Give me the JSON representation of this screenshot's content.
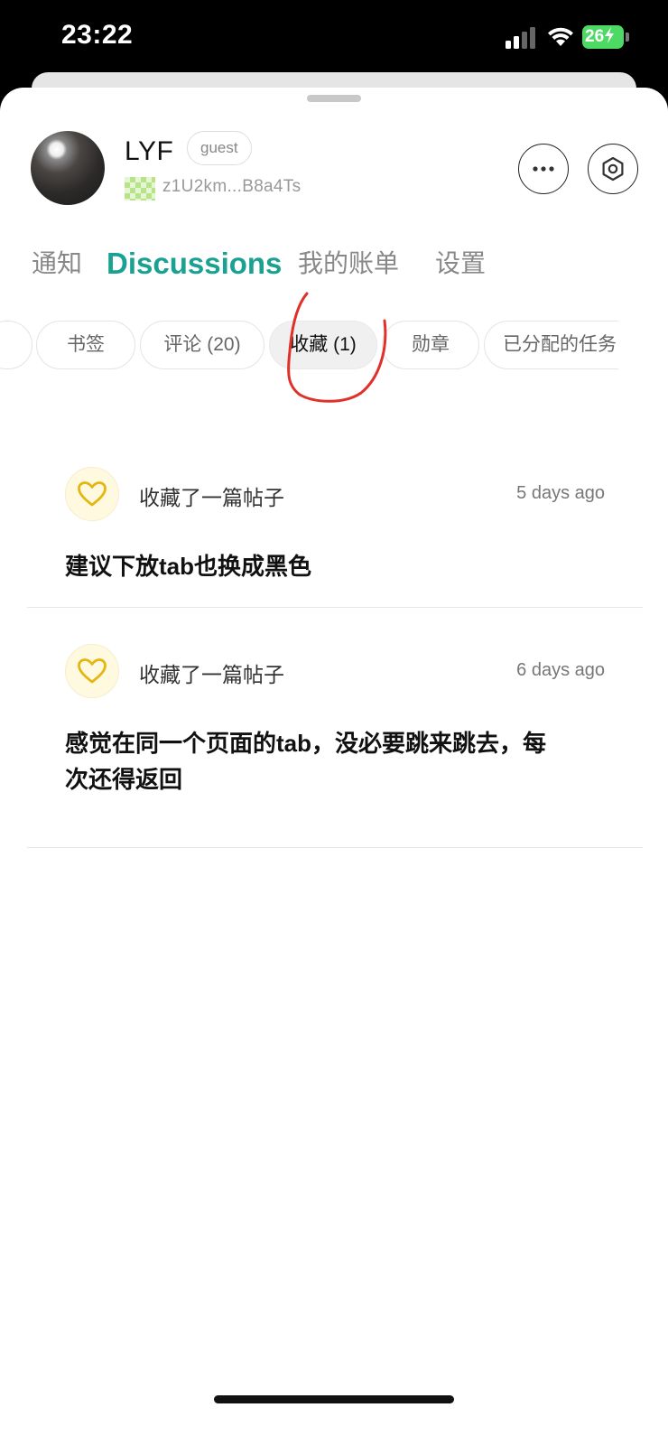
{
  "status_bar": {
    "time": "23:22",
    "battery": "26"
  },
  "profile": {
    "name": "LYF",
    "role": "guest",
    "wallet_address": "z1U2km...B8a4Ts"
  },
  "main_tabs": [
    {
      "label": "通知"
    },
    {
      "label": "Discussions",
      "active": true
    },
    {
      "label": "我的账单"
    },
    {
      "label": "设置"
    }
  ],
  "sub_tabs": [
    {
      "label": "书签"
    },
    {
      "label": "评论 (20)"
    },
    {
      "label": "收藏 (1)",
      "active": true
    },
    {
      "label": "勋章"
    },
    {
      "label": "已分配的任务"
    }
  ],
  "feed": [
    {
      "activity": "收藏了一篇帖子",
      "time": "5 days ago",
      "title": "建议下放tab也换成黑色"
    },
    {
      "activity": "收藏了一篇帖子",
      "time": "6 days ago",
      "title": "感觉在同一个页面的tab，没必要跳来跳去，每次还得返回"
    }
  ],
  "colors": {
    "accent": "#1aa192",
    "heart": "#e5b611",
    "annotation": "#e0302a"
  }
}
